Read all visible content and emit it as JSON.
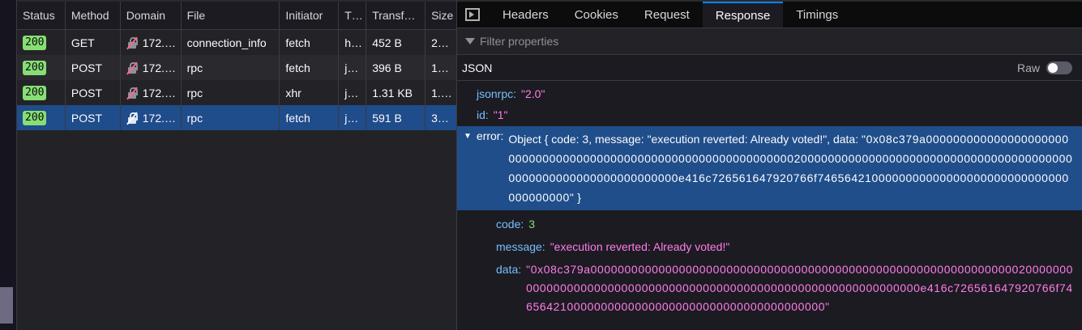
{
  "network": {
    "headers": [
      "Status",
      "Method",
      "Domain",
      "File",
      "Initiator",
      "T…",
      "Transf…",
      "Size"
    ],
    "rows": [
      {
        "status": "200",
        "method": "GET",
        "domain": "172.…",
        "file": "connection_info",
        "initiator": "fetch",
        "type": "h…",
        "transferred": "452 B",
        "size": "2…"
      },
      {
        "status": "200",
        "method": "POST",
        "domain": "172.…",
        "file": "rpc",
        "initiator": "fetch",
        "type": "j…",
        "transferred": "396 B",
        "size": "1…"
      },
      {
        "status": "200",
        "method": "POST",
        "domain": "172.…",
        "file": "rpc",
        "initiator": "xhr",
        "type": "j…",
        "transferred": "1.31 KB",
        "size": "1.…"
      },
      {
        "status": "200",
        "method": "POST",
        "domain": "172.…",
        "file": "rpc",
        "initiator": "fetch",
        "type": "j…",
        "transferred": "591 B",
        "size": "3…"
      }
    ]
  },
  "details": {
    "tabs": [
      "Headers",
      "Cookies",
      "Request",
      "Response",
      "Timings"
    ],
    "active_tab": "Response",
    "filter_placeholder": "Filter properties",
    "section": "JSON",
    "raw_label": "Raw",
    "raw_on": false,
    "jsonrpc_key": "jsonrpc:",
    "jsonrpc_val": "\"2.0\"",
    "id_key": "id:",
    "id_val": "\"1\"",
    "error_key": "error:",
    "error_summary_pre": "Object { code: 3, message: \"execution reverted: Already voted!\", data: ",
    "error_summary_hex": "\"0x08c379a000000000000000000000000000000000000000000000000000000000000000200000000000000000000000000000000000000000000000000000000000000000e416c726561647920766f7465642100000000000000000000000000000000000000\"",
    "error_summary_post": " }",
    "code_key": "code:",
    "code_val": "3",
    "message_key": "message:",
    "message_val": "\"execution reverted: Already voted!\"",
    "data_key": "data:",
    "data_val": "\"0x08c379a000000000000000000000000000000000000000000000000000000000000000200000000000000000000000000000000000000000000000000000000000000000e416c726561647920766f7465642100000000000000000000000000000000000000\""
  }
}
